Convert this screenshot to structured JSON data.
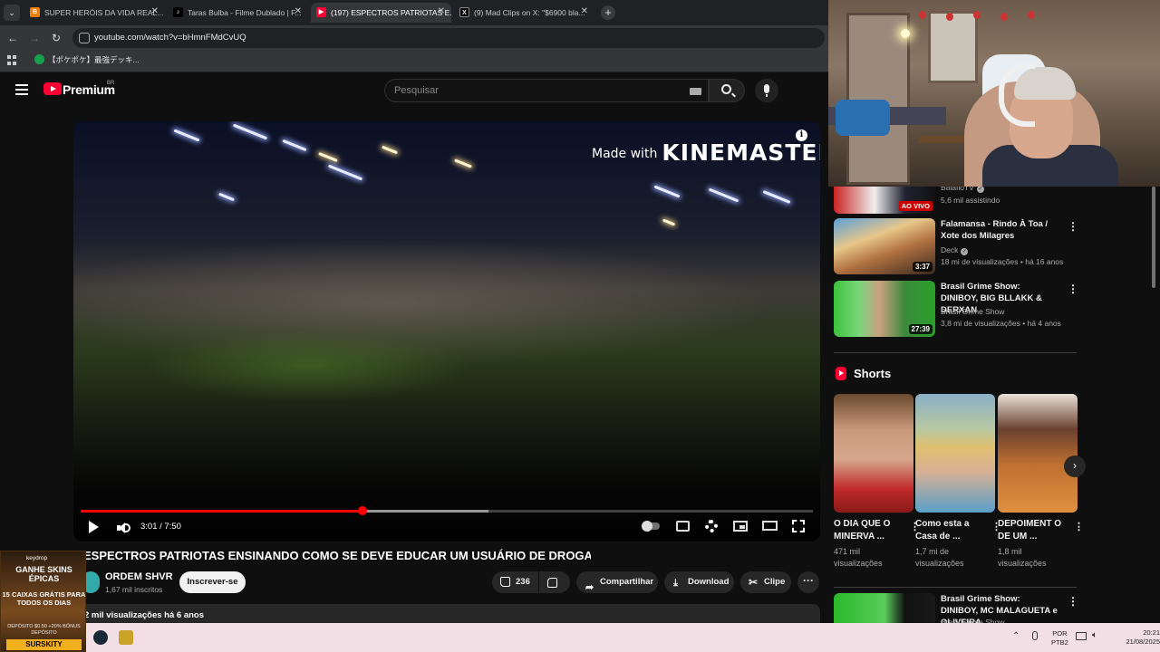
{
  "browser": {
    "tabs": [
      {
        "title": "SUPER HERÓIS DA VIDA REAL...",
        "favicon": "blogger",
        "color": "#f57d00",
        "active": false
      },
      {
        "title": "Taras Bulba - Filme Dublado | F...",
        "favicon": "tiktok",
        "color": "#000000",
        "active": false
      },
      {
        "title": "(197) ESPECTROS PATRIOTAS E...",
        "favicon": "youtube",
        "color": "#ff0033",
        "active": true
      },
      {
        "title": "(9) Mad Clips on X: \"$6900 bla...",
        "favicon": "x",
        "color": "#000000",
        "active": false
      }
    ],
    "url": "youtube.com/watch?v=bHmnFMdCvUQ",
    "bookmark": "【ポケポケ】最強デッキ..."
  },
  "youtube": {
    "brand": "Premium",
    "region": "BR",
    "search_placeholder": "Pesquisar"
  },
  "player": {
    "watermark_made_with": "Made with",
    "watermark_brand": "KINEMASTER",
    "current_time": "3:01",
    "duration": "7:50",
    "time_display": "3:01 / 7:50",
    "progress": 0.385
  },
  "video": {
    "title": "ESPECTROS PATRIOTAS ENSINANDO COMO SE DEVE EDUCAR UM USUÁRIO DE DROGAS.",
    "channel": "ORDEM SHVR",
    "subscribers": "1,67 mil inscritos",
    "subscribe_label": "Inscrever-se",
    "likes": "236",
    "share_label": "Compartilhar",
    "download_label": "Download",
    "clip_label": "Clipe",
    "description_line": "2 mil visualizações  há 6 anos"
  },
  "sidebar": {
    "recommendations": [
      {
        "title": "",
        "channel": "BalafioTV",
        "meta": "5,6 mil assistindo",
        "badge": "AO VIVO"
      },
      {
        "title": "Falamansa - Rindo À Toa / Xote dos Milagres",
        "channel": "Deck",
        "meta": "18 mi de visualizações • há 16 anos",
        "badge": "3:37"
      },
      {
        "title": "Brasil Grime Show: DINIBOY, BIG BLLAKK & DERXAN",
        "channel": "Brasil Grime Show",
        "meta": "3,8 mi de visualizações • há 4 anos",
        "badge": "27:39"
      }
    ],
    "shorts_title": "Shorts",
    "shorts": [
      {
        "title": "O DIA QUE O MINERVA ...",
        "views": "471 mil visualizações"
      },
      {
        "title": "Como esta a Casa de ...",
        "views": "1,7 mi de visualizações"
      },
      {
        "title": "DEPOIMENT O DE UM ...",
        "views": "1,8 mil visualizações"
      }
    ],
    "bottom_rec": {
      "title": "Brasil Grime Show: DINIBOY, MC MALAGUETA e OLIVEIRA",
      "channel": "Brasil Grime Show"
    }
  },
  "ad": {
    "brand": "keydrop",
    "headline": "GANHE SKINS ÉPICAS",
    "middle": "15 CAIXAS GRÁTIS PARA TODOS OS DIAS",
    "small": "DEPÓSITO $0.50 +20% BÔNUS DEPÓSITO",
    "code": "SURSKITY"
  },
  "taskbar": {
    "lang_top": "POR",
    "lang_bottom": "PTB2",
    "time": "20:21",
    "date": "21/08/2025"
  }
}
